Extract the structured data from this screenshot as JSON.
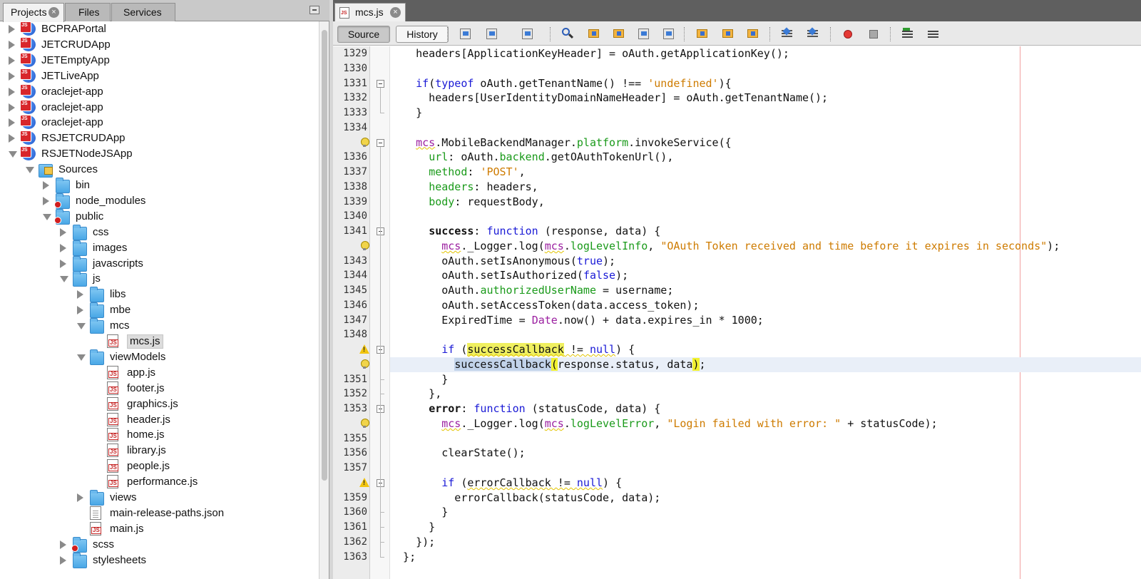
{
  "left_panel": {
    "tabs": [
      {
        "label": "Projects",
        "active": true,
        "closable": true
      },
      {
        "label": "Files",
        "active": false,
        "closable": false
      },
      {
        "label": "Services",
        "active": false,
        "closable": false
      }
    ],
    "tree": [
      {
        "label": "BCPRAPortal",
        "depth": 0,
        "state": "collapsed",
        "icon": "project-icon",
        "error": false
      },
      {
        "label": "JETCRUDApp",
        "depth": 0,
        "state": "collapsed",
        "icon": "project-icon",
        "error": false
      },
      {
        "label": "JETEmptyApp",
        "depth": 0,
        "state": "collapsed",
        "icon": "project-icon",
        "error": false
      },
      {
        "label": "JETLiveApp",
        "depth": 0,
        "state": "collapsed",
        "icon": "project-icon",
        "error": false
      },
      {
        "label": "oraclejet-app",
        "depth": 0,
        "state": "collapsed",
        "icon": "project-icon",
        "error": true
      },
      {
        "label": "oraclejet-app",
        "depth": 0,
        "state": "collapsed",
        "icon": "project-icon",
        "error": true
      },
      {
        "label": "oraclejet-app",
        "depth": 0,
        "state": "collapsed",
        "icon": "project-icon",
        "error": true
      },
      {
        "label": "RSJETCRUDApp",
        "depth": 0,
        "state": "collapsed",
        "icon": "project-icon",
        "error": false
      },
      {
        "label": "RSJETNodeJSApp",
        "depth": 0,
        "state": "expanded",
        "icon": "project-icon",
        "error": true
      },
      {
        "label": "Sources",
        "depth": 1,
        "state": "expanded",
        "icon": "sources-icon",
        "error": false
      },
      {
        "label": "bin",
        "depth": 2,
        "state": "collapsed",
        "icon": "folder-icon",
        "error": false
      },
      {
        "label": "node_modules",
        "depth": 2,
        "state": "collapsed",
        "icon": "folder-icon",
        "error": true
      },
      {
        "label": "public",
        "depth": 2,
        "state": "expanded",
        "icon": "folder-icon",
        "error": true
      },
      {
        "label": "css",
        "depth": 3,
        "state": "collapsed",
        "icon": "folder-icon",
        "error": false
      },
      {
        "label": "images",
        "depth": 3,
        "state": "collapsed",
        "icon": "folder-icon",
        "error": false
      },
      {
        "label": "javascripts",
        "depth": 3,
        "state": "collapsed",
        "icon": "folder-icon",
        "error": false
      },
      {
        "label": "js",
        "depth": 3,
        "state": "expanded",
        "icon": "folder-icon",
        "error": false
      },
      {
        "label": "libs",
        "depth": 4,
        "state": "collapsed",
        "icon": "folder-icon",
        "error": false
      },
      {
        "label": "mbe",
        "depth": 4,
        "state": "collapsed",
        "icon": "folder-icon",
        "error": false
      },
      {
        "label": "mcs",
        "depth": 4,
        "state": "expanded",
        "icon": "folder-icon",
        "error": false
      },
      {
        "label": "mcs.js",
        "depth": 5,
        "state": "leaf",
        "icon": "js-file-icon",
        "error": false,
        "selected": true
      },
      {
        "label": "viewModels",
        "depth": 4,
        "state": "expanded",
        "icon": "folder-icon",
        "error": false
      },
      {
        "label": "app.js",
        "depth": 5,
        "state": "leaf",
        "icon": "js-file-icon",
        "error": false
      },
      {
        "label": "footer.js",
        "depth": 5,
        "state": "leaf",
        "icon": "js-file-icon",
        "error": false
      },
      {
        "label": "graphics.js",
        "depth": 5,
        "state": "leaf",
        "icon": "js-file-icon",
        "error": false
      },
      {
        "label": "header.js",
        "depth": 5,
        "state": "leaf",
        "icon": "js-file-icon",
        "error": false
      },
      {
        "label": "home.js",
        "depth": 5,
        "state": "leaf",
        "icon": "js-file-icon",
        "error": false
      },
      {
        "label": "library.js",
        "depth": 5,
        "state": "leaf",
        "icon": "js-file-icon",
        "error": false
      },
      {
        "label": "people.js",
        "depth": 5,
        "state": "leaf",
        "icon": "js-file-icon",
        "error": false
      },
      {
        "label": "performance.js",
        "depth": 5,
        "state": "leaf",
        "icon": "js-file-icon",
        "error": false
      },
      {
        "label": "views",
        "depth": 4,
        "state": "collapsed",
        "icon": "folder-icon",
        "error": false
      },
      {
        "label": "main-release-paths.json",
        "depth": 4,
        "state": "leaf",
        "icon": "json-file-icon",
        "error": false
      },
      {
        "label": "main.js",
        "depth": 4,
        "state": "leaf",
        "icon": "js-file-icon",
        "error": false
      },
      {
        "label": "scss",
        "depth": 3,
        "state": "collapsed",
        "icon": "folder-icon",
        "error": true
      },
      {
        "label": "stylesheets",
        "depth": 3,
        "state": "collapsed",
        "icon": "folder-icon",
        "error": false
      }
    ]
  },
  "editor": {
    "tab": {
      "label": "mcs.js"
    },
    "toolbar": {
      "source_label": "Source",
      "history_label": "History",
      "icons": [
        "last-edit-icon",
        "back-icon",
        "forward-icon",
        "find-icon",
        "find-previous-icon",
        "find-next-icon",
        "toggle-highlight-icon",
        "rectangular-selection-icon",
        "previous-bookmark-icon",
        "next-bookmark-icon",
        "toggle-bookmark-icon",
        "shift-left-icon",
        "shift-right-icon",
        "start-macro-icon",
        "stop-macro-icon",
        "comment-icon",
        "uncomment-icon"
      ]
    },
    "colors": {
      "keyword": "#1a1ad6",
      "string": "#ce7b00",
      "property": "#1a9a1a",
      "global": "#9b1fa0",
      "margin": "#f2a0a0"
    },
    "lines": [
      {
        "n": "1329",
        "fold": "none",
        "hint": "none",
        "segs": [
          [
            "",
            "    headers[ApplicationKeyHeader] = oAuth.getApplicationKey();"
          ]
        ]
      },
      {
        "n": "1330",
        "fold": "none",
        "hint": "none",
        "segs": []
      },
      {
        "n": "1331",
        "fold": "open",
        "hint": "none",
        "segs": [
          [
            "",
            "    "
          ],
          [
            "k",
            "if"
          ],
          [
            "",
            "("
          ],
          [
            "k",
            "typeof"
          ],
          [
            "",
            " oAuth.getTenantName() !== "
          ],
          [
            "s",
            "'undefined'"
          ],
          [
            "",
            "){"
          ]
        ]
      },
      {
        "n": "1332",
        "fold": "none",
        "hint": "none",
        "segs": [
          [
            "",
            "      headers[UserIdentityDomainNameHeader] = oAuth.getTenantName();"
          ]
        ]
      },
      {
        "n": "1333",
        "fold": "end",
        "hint": "none",
        "segs": [
          [
            "",
            "    }"
          ]
        ]
      },
      {
        "n": "1334",
        "fold": "none",
        "hint": "none",
        "segs": []
      },
      {
        "n": "",
        "fold": "open",
        "hint": "bulb",
        "segs": [
          [
            "",
            "    "
          ],
          [
            "v wavy",
            "mcs"
          ],
          [
            "",
            ".MobileBackendManager."
          ],
          [
            "p",
            "platform"
          ],
          [
            "",
            ".invokeService({"
          ]
        ]
      },
      {
        "n": "1336",
        "fold": "none",
        "hint": "none",
        "segs": [
          [
            "",
            "      "
          ],
          [
            "p",
            "url"
          ],
          [
            "",
            ": oAuth."
          ],
          [
            "p",
            "backend"
          ],
          [
            "",
            ".getOAuthTokenUrl(),"
          ]
        ]
      },
      {
        "n": "1337",
        "fold": "none",
        "hint": "none",
        "segs": [
          [
            "",
            "      "
          ],
          [
            "p",
            "method"
          ],
          [
            "",
            ": "
          ],
          [
            "s",
            "'POST'"
          ],
          [
            "",
            ","
          ]
        ]
      },
      {
        "n": "1338",
        "fold": "none",
        "hint": "none",
        "segs": [
          [
            "",
            "      "
          ],
          [
            "p",
            "headers"
          ],
          [
            "",
            ": headers,"
          ]
        ]
      },
      {
        "n": "1339",
        "fold": "none",
        "hint": "none",
        "segs": [
          [
            "",
            "      "
          ],
          [
            "p",
            "body"
          ],
          [
            "",
            ": requestBody,"
          ]
        ]
      },
      {
        "n": "1340",
        "fold": "none",
        "hint": "none",
        "segs": []
      },
      {
        "n": "1341",
        "fold": "open",
        "hint": "none",
        "segs": [
          [
            "",
            "      "
          ],
          [
            "b",
            "success"
          ],
          [
            "",
            ": "
          ],
          [
            "k",
            "function"
          ],
          [
            "",
            " (response, data) {"
          ]
        ]
      },
      {
        "n": "",
        "fold": "none",
        "hint": "bulb",
        "segs": [
          [
            "",
            "        "
          ],
          [
            "v wavy",
            "mcs"
          ],
          [
            "",
            "._Logger.log("
          ],
          [
            "v wavy",
            "mcs"
          ],
          [
            "",
            "."
          ],
          [
            "p",
            "logLevelInfo"
          ],
          [
            "",
            ", "
          ],
          [
            "s",
            "\"OAuth Token received and time before it expires in seconds\""
          ],
          [
            "",
            ");"
          ]
        ]
      },
      {
        "n": "1343",
        "fold": "none",
        "hint": "none",
        "segs": [
          [
            "",
            "        oAuth.setIsAnonymous("
          ],
          [
            "k",
            "true"
          ],
          [
            "",
            ");"
          ]
        ]
      },
      {
        "n": "1344",
        "fold": "none",
        "hint": "none",
        "segs": [
          [
            "",
            "        oAuth.setIsAuthorized("
          ],
          [
            "k",
            "false"
          ],
          [
            "",
            ");"
          ]
        ]
      },
      {
        "n": "1345",
        "fold": "none",
        "hint": "none",
        "segs": [
          [
            "",
            "        oAuth."
          ],
          [
            "p",
            "authorizedUserName"
          ],
          [
            "",
            " = username;"
          ]
        ]
      },
      {
        "n": "1346",
        "fold": "none",
        "hint": "none",
        "segs": [
          [
            "",
            "        oAuth.setAccessToken(data.access_token);"
          ]
        ]
      },
      {
        "n": "1347",
        "fold": "none",
        "hint": "none",
        "segs": [
          [
            "",
            "        ExpiredTime = "
          ],
          [
            "v",
            "Date"
          ],
          [
            "",
            ".now() + data.expires_in * 1000;"
          ]
        ]
      },
      {
        "n": "1348",
        "fold": "none",
        "hint": "none",
        "segs": []
      },
      {
        "n": "",
        "fold": "open",
        "hint": "warn",
        "segs": [
          [
            "",
            "        "
          ],
          [
            "k",
            "if"
          ],
          [
            "",
            " ("
          ],
          [
            "mk wavy",
            "successCallback"
          ],
          [
            "wavy",
            " != "
          ],
          [
            "k wavy",
            "null"
          ],
          [
            "",
            ") {"
          ]
        ]
      },
      {
        "n": "",
        "fold": "none",
        "hint": "bulb",
        "hl": true,
        "segs": [
          [
            "",
            "          "
          ],
          [
            "sel",
            "successCallback"
          ],
          [
            "br",
            "("
          ],
          [
            "",
            "response.status, data"
          ],
          [
            "br",
            ")"
          ],
          [
            "",
            ";"
          ]
        ]
      },
      {
        "n": "1351",
        "fold": "end",
        "hint": "none",
        "segs": [
          [
            "",
            "        }"
          ]
        ]
      },
      {
        "n": "1352",
        "fold": "end",
        "hint": "none",
        "segs": [
          [
            "",
            "      },"
          ]
        ]
      },
      {
        "n": "1353",
        "fold": "open",
        "hint": "none",
        "segs": [
          [
            "",
            "      "
          ],
          [
            "b",
            "error"
          ],
          [
            "",
            ": "
          ],
          [
            "k",
            "function"
          ],
          [
            "",
            " (statusCode, data) {"
          ]
        ]
      },
      {
        "n": "",
        "fold": "none",
        "hint": "bulb",
        "segs": [
          [
            "",
            "        "
          ],
          [
            "v wavy",
            "mcs"
          ],
          [
            "",
            "._Logger.log("
          ],
          [
            "v wavy",
            "mcs"
          ],
          [
            "",
            "."
          ],
          [
            "p",
            "logLevelError"
          ],
          [
            "",
            ", "
          ],
          [
            "s",
            "\"Login failed with error: \""
          ],
          [
            "",
            " + statusCode);"
          ]
        ]
      },
      {
        "n": "1355",
        "fold": "none",
        "hint": "none",
        "segs": []
      },
      {
        "n": "1356",
        "fold": "none",
        "hint": "none",
        "segs": [
          [
            "",
            "        clearState();"
          ]
        ]
      },
      {
        "n": "1357",
        "fold": "none",
        "hint": "none",
        "segs": []
      },
      {
        "n": "",
        "fold": "open",
        "hint": "warn",
        "segs": [
          [
            "",
            "        "
          ],
          [
            "k",
            "if"
          ],
          [
            "",
            " ("
          ],
          [
            "wavy",
            "errorCallback != "
          ],
          [
            "k wavy",
            "null"
          ],
          [
            "",
            ") {"
          ]
        ]
      },
      {
        "n": "1359",
        "fold": "none",
        "hint": "none",
        "segs": [
          [
            "",
            "          errorCallback(statusCode, data);"
          ]
        ]
      },
      {
        "n": "1360",
        "fold": "end",
        "hint": "none",
        "segs": [
          [
            "",
            "        }"
          ]
        ]
      },
      {
        "n": "1361",
        "fold": "end",
        "hint": "none",
        "segs": [
          [
            "",
            "      }"
          ]
        ]
      },
      {
        "n": "1362",
        "fold": "end",
        "hint": "none",
        "segs": [
          [
            "",
            "    });"
          ]
        ]
      },
      {
        "n": "1363",
        "fold": "end",
        "hint": "none",
        "segs": [
          [
            "",
            "  };"
          ]
        ]
      }
    ]
  }
}
